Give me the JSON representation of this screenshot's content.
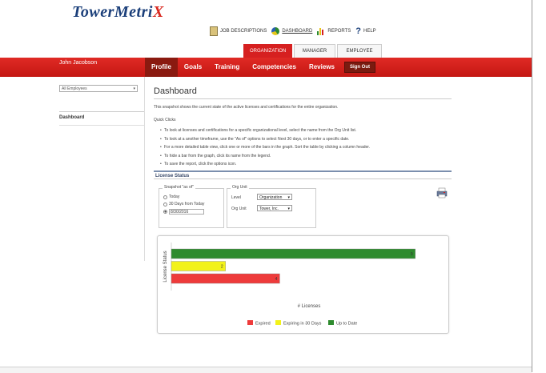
{
  "brand": {
    "logo_main": "TowerMetri",
    "logo_x": "X"
  },
  "topnav": [
    {
      "label": "JOB DESCRIPTIONS",
      "icon": "document-icon"
    },
    {
      "label": "DASHBOARD",
      "icon": "pie-chart-icon"
    },
    {
      "label": "REPORTS",
      "icon": "bar-chart-icon"
    },
    {
      "label": "HELP",
      "icon": "question-icon"
    }
  ],
  "role_tabs": [
    "ORGANIZATION",
    "MANAGER",
    "EMPLOYEE"
  ],
  "user": {
    "name": "John Jacobson"
  },
  "main_nav": [
    "Profile",
    "Goals",
    "Training",
    "Competencies",
    "Reviews"
  ],
  "signout": "Sign Out",
  "sidebar": {
    "filter_value": "All Employees",
    "items": [
      "Dashboard"
    ]
  },
  "page": {
    "title": "Dashboard",
    "description": "This snapshot shows the current state of the active licenses and certifications for the entire organization.",
    "quick_clicks": "Quick Clicks",
    "bullets": [
      "To look at licenses and certifications for a specific organizational level, select the name from the Org Unit list.",
      "To look at a another timeframe, use the \"As of\" options to select Next 30 days, or to enter a specific date.",
      "For a more detailed table view, click one or more of the bars in the graph. Sort the table by clicking a column header.",
      "To hide a bar from the graph, click its name from the legend.",
      "To save the report, click the options icon."
    ]
  },
  "license_status": {
    "header": "License Status",
    "snapshot": {
      "legend": "Snapshot \"as of\"",
      "options": [
        "Today",
        "30 Days from Today"
      ],
      "date_value": "8/30/2016"
    },
    "org_unit": {
      "legend": "Org Unit",
      "level_label": "Level",
      "level_value": "Organization",
      "unit_label": "Org Unit",
      "unit_value": "Tower, Inc."
    }
  },
  "chart_data": {
    "type": "bar",
    "orientation": "horizontal",
    "categories": [
      "Up to Date",
      "Expiring in 30 Days",
      "Expired"
    ],
    "values": [
      9,
      2,
      4
    ],
    "value_labels": [
      "9",
      "2",
      "4"
    ],
    "xlabel": "# Licenses",
    "ylabel": "License Status",
    "xlim": [
      0,
      9.6
    ],
    "colors": [
      "#2e8b2e",
      "#f2f21a",
      "#ee3b3b"
    ],
    "legend": [
      {
        "name": "Expired",
        "color": "#ee3b3b"
      },
      {
        "name": "Expiring in 30 Days",
        "color": "#f2f21a"
      },
      {
        "name": "Up to Date",
        "color": "#2e8b2e"
      }
    ],
    "legend_position": "bottom",
    "grid": false
  }
}
